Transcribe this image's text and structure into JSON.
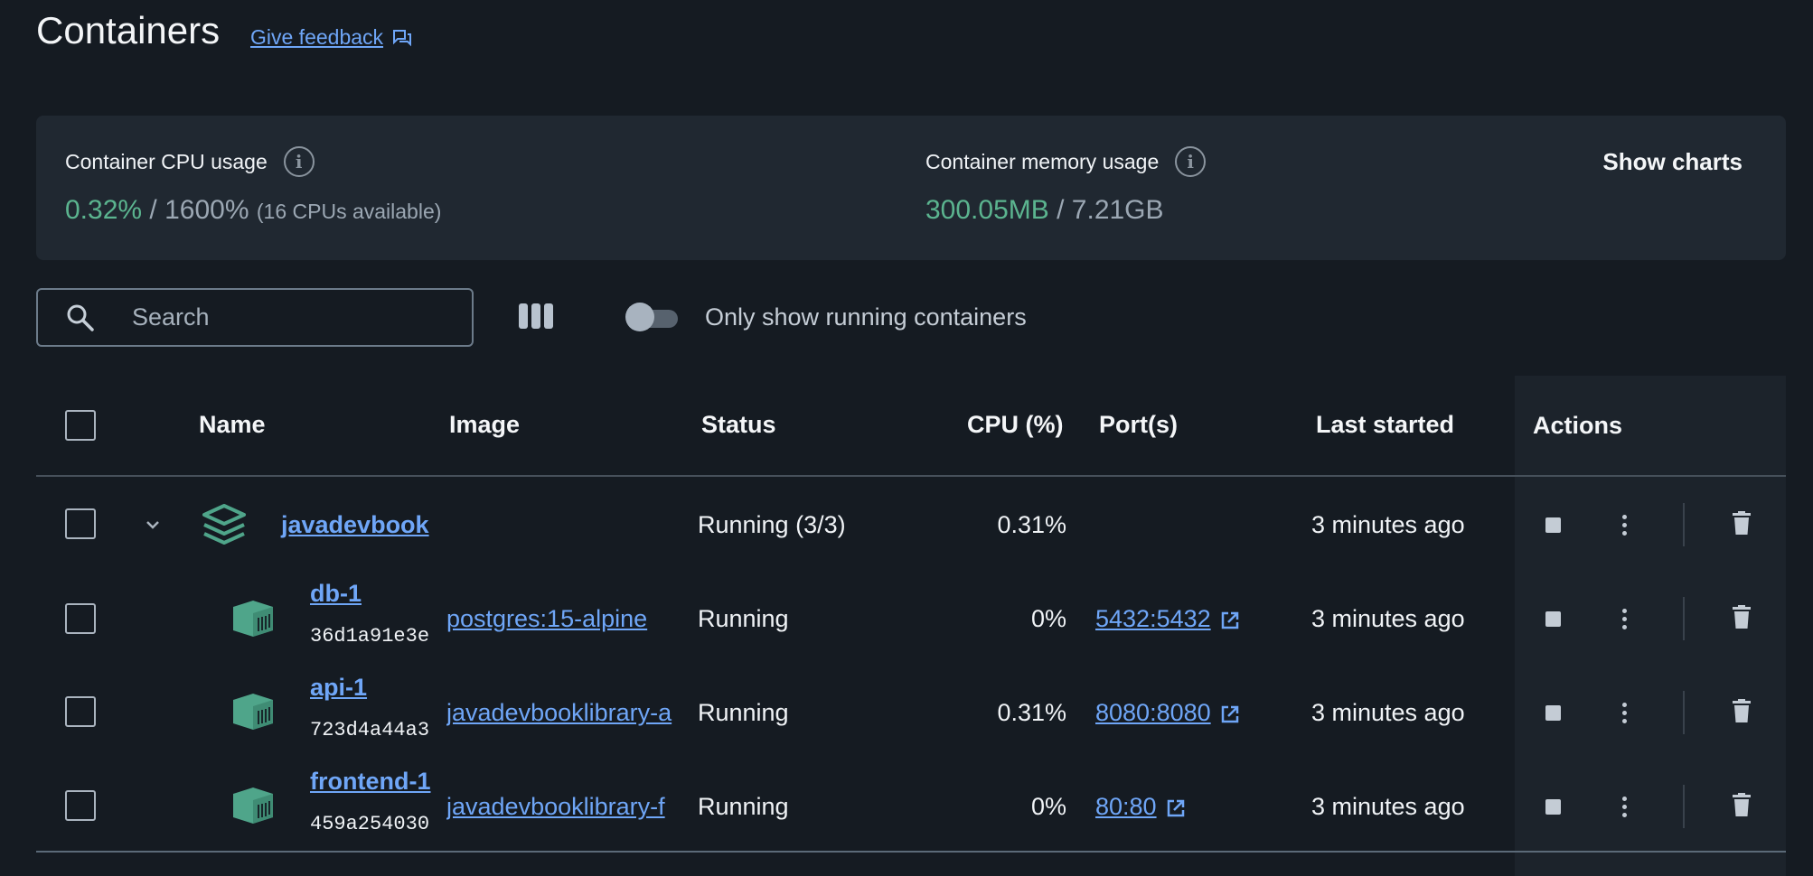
{
  "header": {
    "title": "Containers",
    "feedback_label": "Give feedback"
  },
  "stats": {
    "cpu": {
      "label": "Container CPU usage",
      "used": "0.32%",
      "separator": "/",
      "total": "1600%",
      "note": "(16 CPUs available)"
    },
    "memory": {
      "label": "Container memory usage",
      "used": "300.05MB",
      "separator": "/",
      "total": "7.21GB"
    },
    "show_charts_label": "Show charts"
  },
  "toolbar": {
    "search_placeholder": "Search",
    "search_value": "",
    "toggle_label": "Only show running containers",
    "toggle_on": false
  },
  "table": {
    "columns": {
      "name": "Name",
      "image": "Image",
      "status": "Status",
      "cpu": "CPU (%)",
      "ports": "Port(s)",
      "last_started": "Last started",
      "actions": "Actions"
    },
    "group": {
      "name": "javadevbook",
      "status": "Running (3/3)",
      "cpu": "0.31%",
      "last_started": "3 minutes ago",
      "expanded": true
    },
    "rows": [
      {
        "name": "db-1",
        "id": "36d1a91e3e",
        "image": "postgres:15-alpine",
        "status": "Running",
        "cpu": "0%",
        "port": "5432:5432",
        "last_started": "3 minutes ago"
      },
      {
        "name": "api-1",
        "id": "723d4a44a3",
        "image": "javadevbooklibrary-a",
        "status": "Running",
        "cpu": "0.31%",
        "port": "8080:8080",
        "last_started": "3 minutes ago"
      },
      {
        "name": "frontend-1",
        "id": "459a254030",
        "image": "javadevbooklibrary-f",
        "status": "Running",
        "cpu": "0%",
        "port": "80:80",
        "last_started": "3 minutes ago"
      }
    ]
  },
  "colors": {
    "background": "#151b22",
    "card": "#202831",
    "accent_link": "#6fa6f7",
    "usage_green": "#5bb48f",
    "container_icon": "#4fa58a"
  }
}
